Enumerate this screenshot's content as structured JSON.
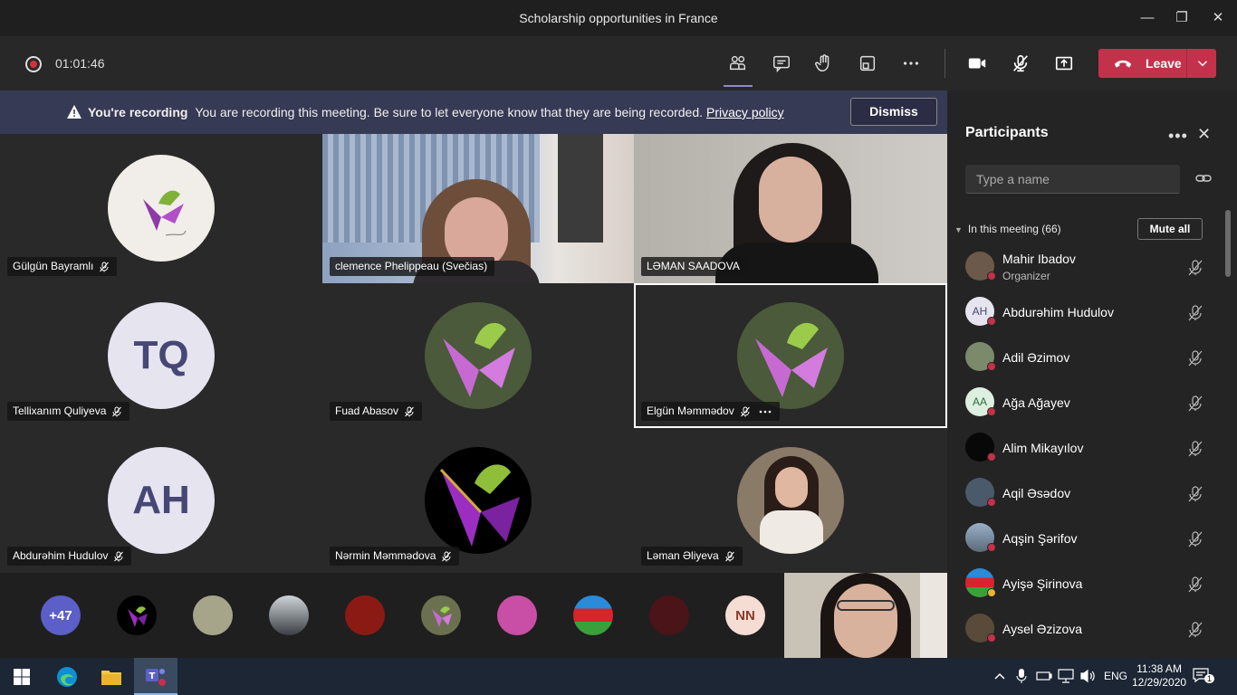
{
  "window": {
    "title": "Scholarship opportunities in France",
    "minimize_glyph": "—",
    "maximize_glyph": "❐",
    "close_glyph": "✕"
  },
  "toolbar": {
    "timer": "01:01:46",
    "leave_label": "Leave",
    "icons": [
      "participants-icon",
      "chat-icon",
      "raise-hand-icon",
      "breakout-icon",
      "more-icon",
      "camera-icon",
      "mic-off-icon",
      "share-icon"
    ]
  },
  "banner": {
    "heading": "You're recording",
    "message": "You are recording this meeting. Be sure to let everyone know that they are being recorded.",
    "link": "Privacy policy",
    "dismiss": "Dismiss"
  },
  "tiles": [
    {
      "name": "Gülgün Bayramlı"
    },
    {
      "name": "clemence Phelippeau (Svečias)"
    },
    {
      "name": "LƏMAN SAADOVA"
    },
    {
      "name": "Tellixanım Quliyeva",
      "initials": "TQ"
    },
    {
      "name": "Fuad Abasov"
    },
    {
      "name": "Elgün Məmmədov"
    },
    {
      "name": "Abdurəhim Hudulov",
      "initials": "AH"
    },
    {
      "name": "Nərmin Məmmədova"
    },
    {
      "name": "Ləman Əliyeva"
    }
  ],
  "strip": {
    "more_count": "+47",
    "last_initials": "NN"
  },
  "panel": {
    "title": "Participants",
    "more_glyph": "•••",
    "close_glyph": "✕",
    "search_placeholder": "Type a name",
    "in_meeting": "In this meeting (66)",
    "mute_all": "Mute all",
    "participants": [
      {
        "name": "Mahir Ibadov",
        "role": "Organizer"
      },
      {
        "name": "Abdurəhim Hudulov",
        "initials": "AH"
      },
      {
        "name": "Adil Əzimov"
      },
      {
        "name": "Ağa Ağayev",
        "initials": "AA"
      },
      {
        "name": "Alim Mikayılov"
      },
      {
        "name": "Aqil Əsədov"
      },
      {
        "name": "Aqşin Şərifov"
      },
      {
        "name": "Ayişə Şirinova"
      },
      {
        "name": "Aysel Əzizova"
      }
    ]
  },
  "taskbar": {
    "lang": "ENG",
    "time": "11:38 AM",
    "date": "12/29/2020",
    "notif_count": "1"
  }
}
